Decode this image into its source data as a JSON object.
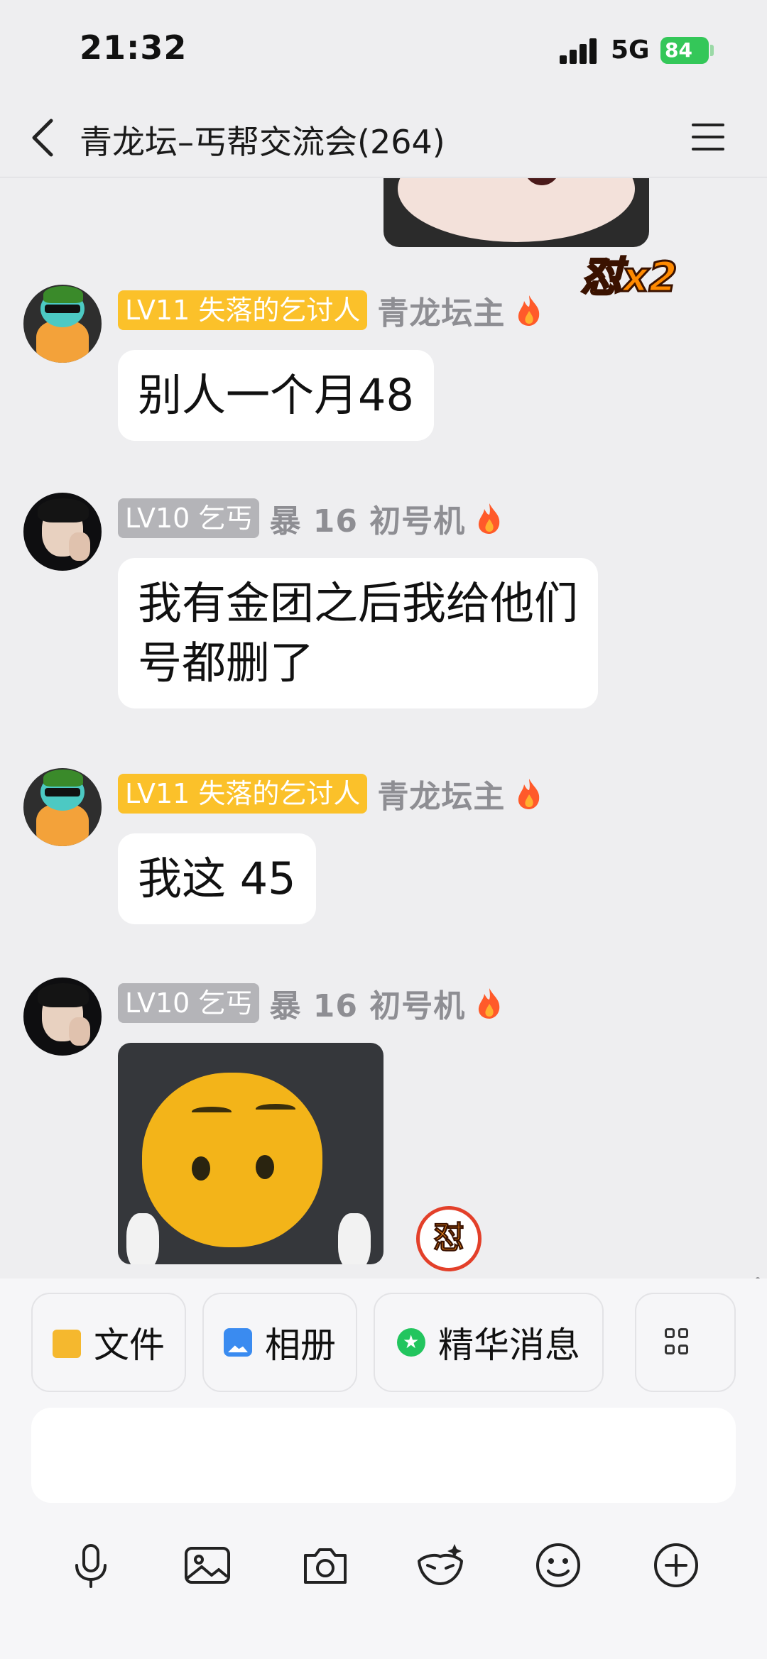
{
  "status_bar": {
    "time": "21:32",
    "network": "5G",
    "battery": "84"
  },
  "nav": {
    "title": "青龙坛–丐帮交流会(264)"
  },
  "chat": {
    "top_reaction": "怼x2",
    "messages": [
      {
        "badge": "LV11 失落的乞讨人",
        "sender": "青龙坛主",
        "text": "别人一个月48"
      },
      {
        "badge": "LV10 乞丐",
        "sender": "暴 16 初号机",
        "text_line1": "我有金团之后我给他们",
        "text_line2": "号都删了"
      },
      {
        "badge": "LV11 失落的乞讨人",
        "sender": "青龙坛主",
        "text": "我这 45"
      },
      {
        "badge": "LV10 乞丐",
        "sender": "暴 16 初号机",
        "reaction": "怼"
      }
    ]
  },
  "quick_actions": [
    {
      "label": "文件",
      "icon": "folder-icon"
    },
    {
      "label": "相册",
      "icon": "photo-icon"
    },
    {
      "label": "精华消息",
      "icon": "star-icon"
    },
    {
      "label": "",
      "icon": "grid-icon"
    }
  ],
  "input": {
    "placeholder": ""
  },
  "toolbar": [
    "microphone-icon",
    "image-icon",
    "camera-icon",
    "mask-icon",
    "emoji-icon",
    "plus-icon"
  ],
  "colors": {
    "background": "#eeeef0",
    "badge_gold": "#fbc12a",
    "badge_gray": "#b4b4b8",
    "battery": "#34c759"
  }
}
